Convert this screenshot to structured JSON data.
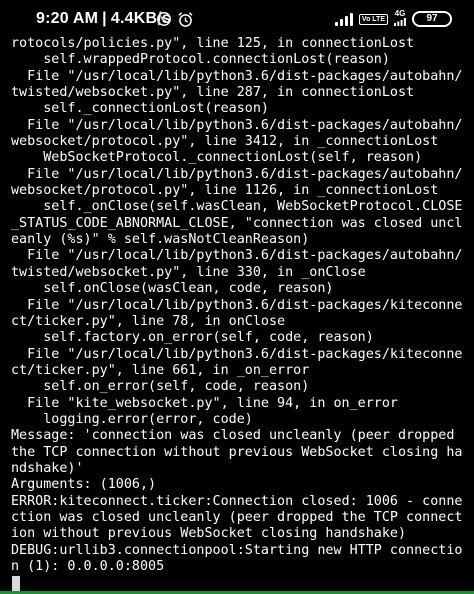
{
  "status_bar": {
    "time": "9:20 AM",
    "separator": "|",
    "network_speed": "4.4KB/s",
    "icons_left": [
      "whatsapp-icon",
      "alarm-icon"
    ],
    "volte_label": "Vo LTE",
    "network_label": "4G",
    "battery_level": "97"
  },
  "terminal": {
    "lines": [
      "rotocols/policies.py\", line 125, in connectionLost",
      "    self.wrappedProtocol.connectionLost(reason)",
      "  File \"/usr/local/lib/python3.6/dist-packages/autobahn/",
      "twisted/websocket.py\", line 287, in connectionLost",
      "    self._connectionLost(reason)",
      "  File \"/usr/local/lib/python3.6/dist-packages/autobahn/",
      "websocket/protocol.py\", line 3412, in _connectionLost",
      "    WebSocketProtocol._connectionLost(self, reason)",
      "  File \"/usr/local/lib/python3.6/dist-packages/autobahn/",
      "websocket/protocol.py\", line 1126, in _connectionLost",
      "    self._onClose(self.wasClean, WebSocketProtocol.CLOSE",
      "_STATUS_CODE_ABNORMAL_CLOSE, \"connection was closed uncl",
      "eanly (%s)\" % self.wasNotCleanReason)",
      "  File \"/usr/local/lib/python3.6/dist-packages/autobahn/",
      "twisted/websocket.py\", line 330, in _onClose",
      "    self.onClose(wasClean, code, reason)",
      "  File \"/usr/local/lib/python3.6/dist-packages/kiteconne",
      "ct/ticker.py\", line 78, in onClose",
      "    self.factory.on_error(self, code, reason)",
      "  File \"/usr/local/lib/python3.6/dist-packages/kiteconne",
      "ct/ticker.py\", line 661, in _on_error",
      "    self.on_error(self, code, reason)",
      "  File \"kite_websocket.py\", line 94, in on_error",
      "    logging.error(error, code)",
      "Message: 'connection was closed uncleanly (peer dropped",
      "the TCP connection without previous WebSocket closing ha",
      "ndshake)'",
      "Arguments: (1006,)",
      "ERROR:kiteconnect.ticker:Connection closed: 1006 - conne",
      "ction was closed uncleanly (peer dropped the TCP connect",
      "ion without previous WebSocket closing handshake)",
      "DEBUG:urllib3.connectionpool:Starting new HTTP connectio",
      "n (1): 0.0.0.0:8005"
    ]
  }
}
